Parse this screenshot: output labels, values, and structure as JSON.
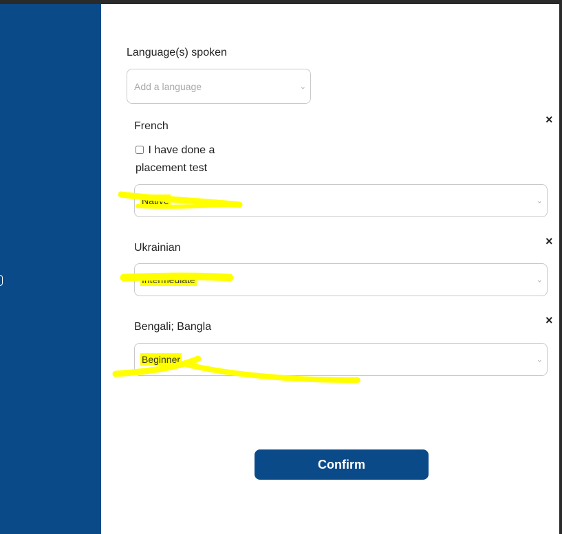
{
  "form": {
    "languages_label": "Language(s) spoken",
    "add_placeholder": "Add a language",
    "languages": [
      {
        "name": "French",
        "placement_test_label": "I have done a placement test",
        "placement_test_checked": false,
        "level": "Native"
      },
      {
        "name": "Ukrainian",
        "level": "Intermediate"
      },
      {
        "name": "Bengali; Bangla",
        "level": "Beginner"
      }
    ],
    "remove_glyph": "×",
    "chevron_glyph": "⌄",
    "confirm_label": "Confirm"
  },
  "colors": {
    "brand": "#0b4a89",
    "highlight": "#ffff00"
  }
}
